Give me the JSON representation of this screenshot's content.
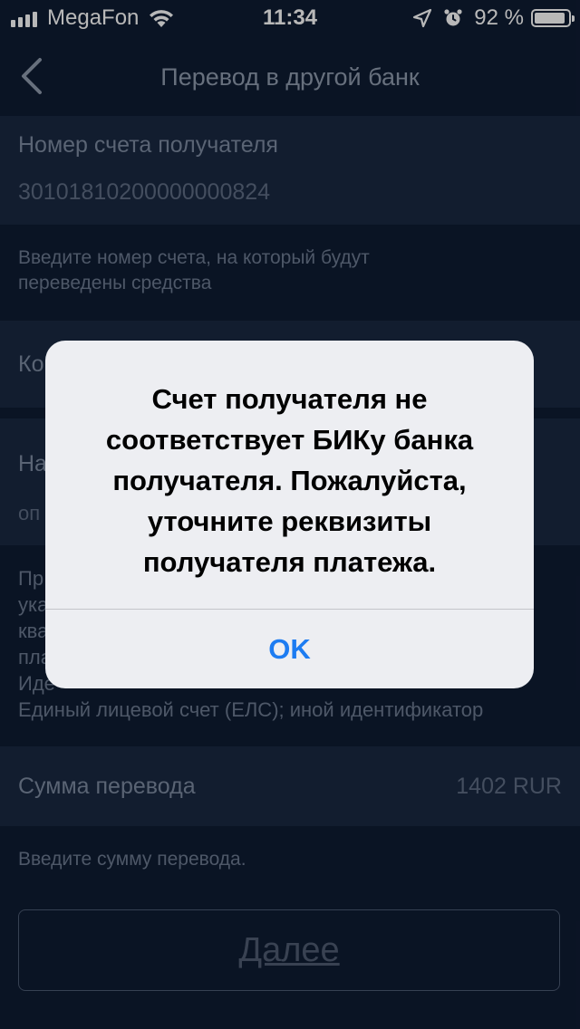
{
  "status_bar": {
    "carrier": "MegaFon",
    "time": "11:34",
    "battery_percent": "92 %",
    "battery_level": 0.92,
    "icons": [
      "signal-icon",
      "wifi-icon",
      "location-arrow-icon",
      "alarm-icon",
      "battery-icon"
    ]
  },
  "nav": {
    "title": "Перевод в другой банк",
    "back_icon": "chevron-left-icon"
  },
  "form": {
    "account": {
      "label": "Номер счета получателя",
      "value": "30101810200000000824",
      "hint_lines": [
        "Введите номер счета, на который будут",
        "переведены средства"
      ]
    },
    "bik": {
      "label_partial": "Ко"
    },
    "name": {
      "label_partial": "На",
      "value_partial": "оп"
    },
    "info": {
      "lines_partial": [
        "Пр",
        "ука",
        "ква",
        "пла",
        "Иде",
        "Единый лицевой счет (ЕЛС); иной идентификатор"
      ]
    },
    "amount": {
      "label": "Сумма перевода",
      "value": "1402  RUR",
      "hint": "Введите сумму перевода."
    },
    "next_button": "Далее"
  },
  "alert": {
    "message": "Счет получателя не соответствует БИКу банка получателя. Пожалуйста, уточните  реквизиты получателя платежа.",
    "ok": "OK"
  },
  "colors": {
    "background": "#0f1c33",
    "field_bg": "#1a2942",
    "alert_bg": "#edeef2",
    "accent": "#1d7cf2"
  }
}
